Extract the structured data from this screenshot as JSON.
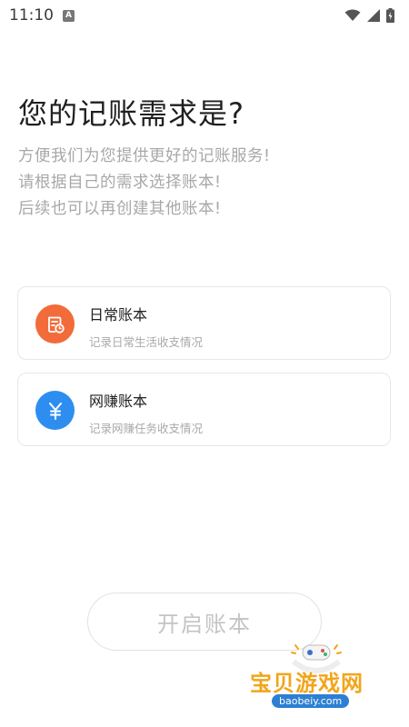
{
  "status_bar": {
    "time": "11:10",
    "notification_glyph": "A"
  },
  "page": {
    "title": "您的记账需求是?",
    "subtitle_lines": [
      "方便我们为您提供更好的记账服务!",
      "请根据自己的需求选择账本!",
      "后续也可以再创建其他账本!"
    ]
  },
  "options": [
    {
      "title": "日常账本",
      "description": "记录日常生活收支情况",
      "icon": "ledger-clock-icon",
      "color": "#f26b3a"
    },
    {
      "title": "网赚账本",
      "description": "记录网赚任务收支情况",
      "icon": "yen-icon",
      "color": "#2e8ef0"
    }
  ],
  "actions": {
    "open_ledger_label": "开启账本"
  },
  "watermark": {
    "text": "宝贝游戏网",
    "url": "baobeiy.com"
  }
}
